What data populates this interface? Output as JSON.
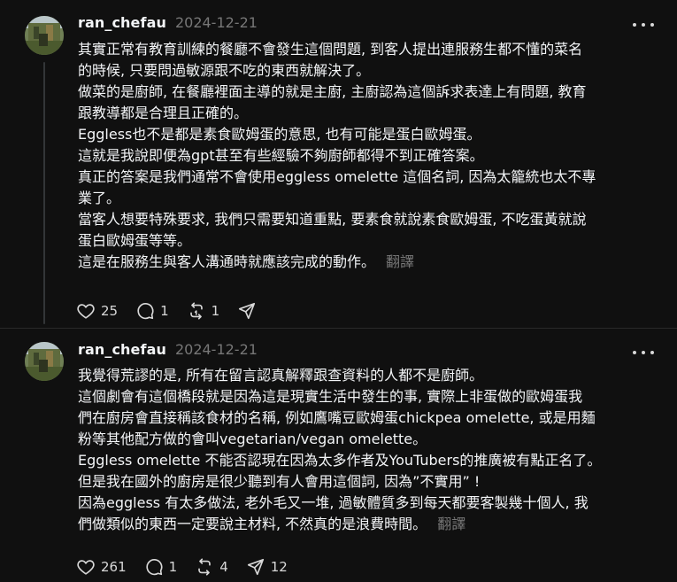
{
  "posts": [
    {
      "username": "ran_chefau",
      "timestamp": "2024-12-21",
      "lines": [
        "其實正常有教育訓練的餐廳不會發生這個問題, 到客人提出連服務生都不懂的菜名",
        "的時候, 只要問過敏源跟不吃的東西就解決了。",
        "做菜的是廚師, 在餐廳裡面主導的就是主廚, 主廚認為這個訴求表達上有問題, 教育",
        "跟教導都是合理且正確的。",
        "Eggless也不是都是素食歐姆蛋的意思, 也有可能是蛋白歐姆蛋。",
        "這就是我說即便為gpt甚至有些經驗不夠廚師都得不到正確答案。",
        "真正的答案是我們通常不會使用eggless omelette 這個名詞, 因為太籠統也太不專",
        "業了。",
        "當客人想要特殊要求, 我們只需要知道重點, 要素食就說素食歐姆蛋, 不吃蛋黃就說",
        "蛋白歐姆蛋等等。",
        "這是在服務生與客人溝通時就應該完成的動作。"
      ],
      "translate_label": "翻譯",
      "likes": "25",
      "replies": "1",
      "reposts": "1",
      "shares": ""
    },
    {
      "username": "ran_chefau",
      "timestamp": "2024-12-21",
      "lines": [
        "我覺得荒謬的是, 所有在留言認真解釋跟查資料的人都不是廚師。",
        "這個劇會有這個橋段就是因為這是現實生活中發生的事, 實際上非蛋做的歐姆蛋我",
        "們在廚房會直接稱該食材的名稱, 例如鷹嘴豆歐姆蛋chickpea omelette, 或是用麵",
        "粉等其他配方做的會叫vegetarian/vegan omelette。",
        "Eggless omelette 不能否認現在因為太多作者及YouTubers的推廣被有點正名了。",
        "但是我在國外的廚房是很少聽到有人會用這個詞, 因為”不實用” !",
        "因為eggless 有太多做法, 老外毛又一堆, 過敏體質多到每天都要客製幾十個人, 我",
        "們做類似的東西一定要說主材料, 不然真的是浪費時間。"
      ],
      "translate_label": "翻譯",
      "likes": "261",
      "replies": "1",
      "reposts": "4",
      "shares": "12"
    }
  ],
  "icons": {
    "like": "heart-icon",
    "reply": "comment-icon",
    "repost": "repost-icon",
    "share": "send-icon",
    "more": "more-horizontal-icon"
  },
  "colors": {
    "background": "#101010",
    "text": "#f3f5f7",
    "secondary_text": "#777777"
  }
}
